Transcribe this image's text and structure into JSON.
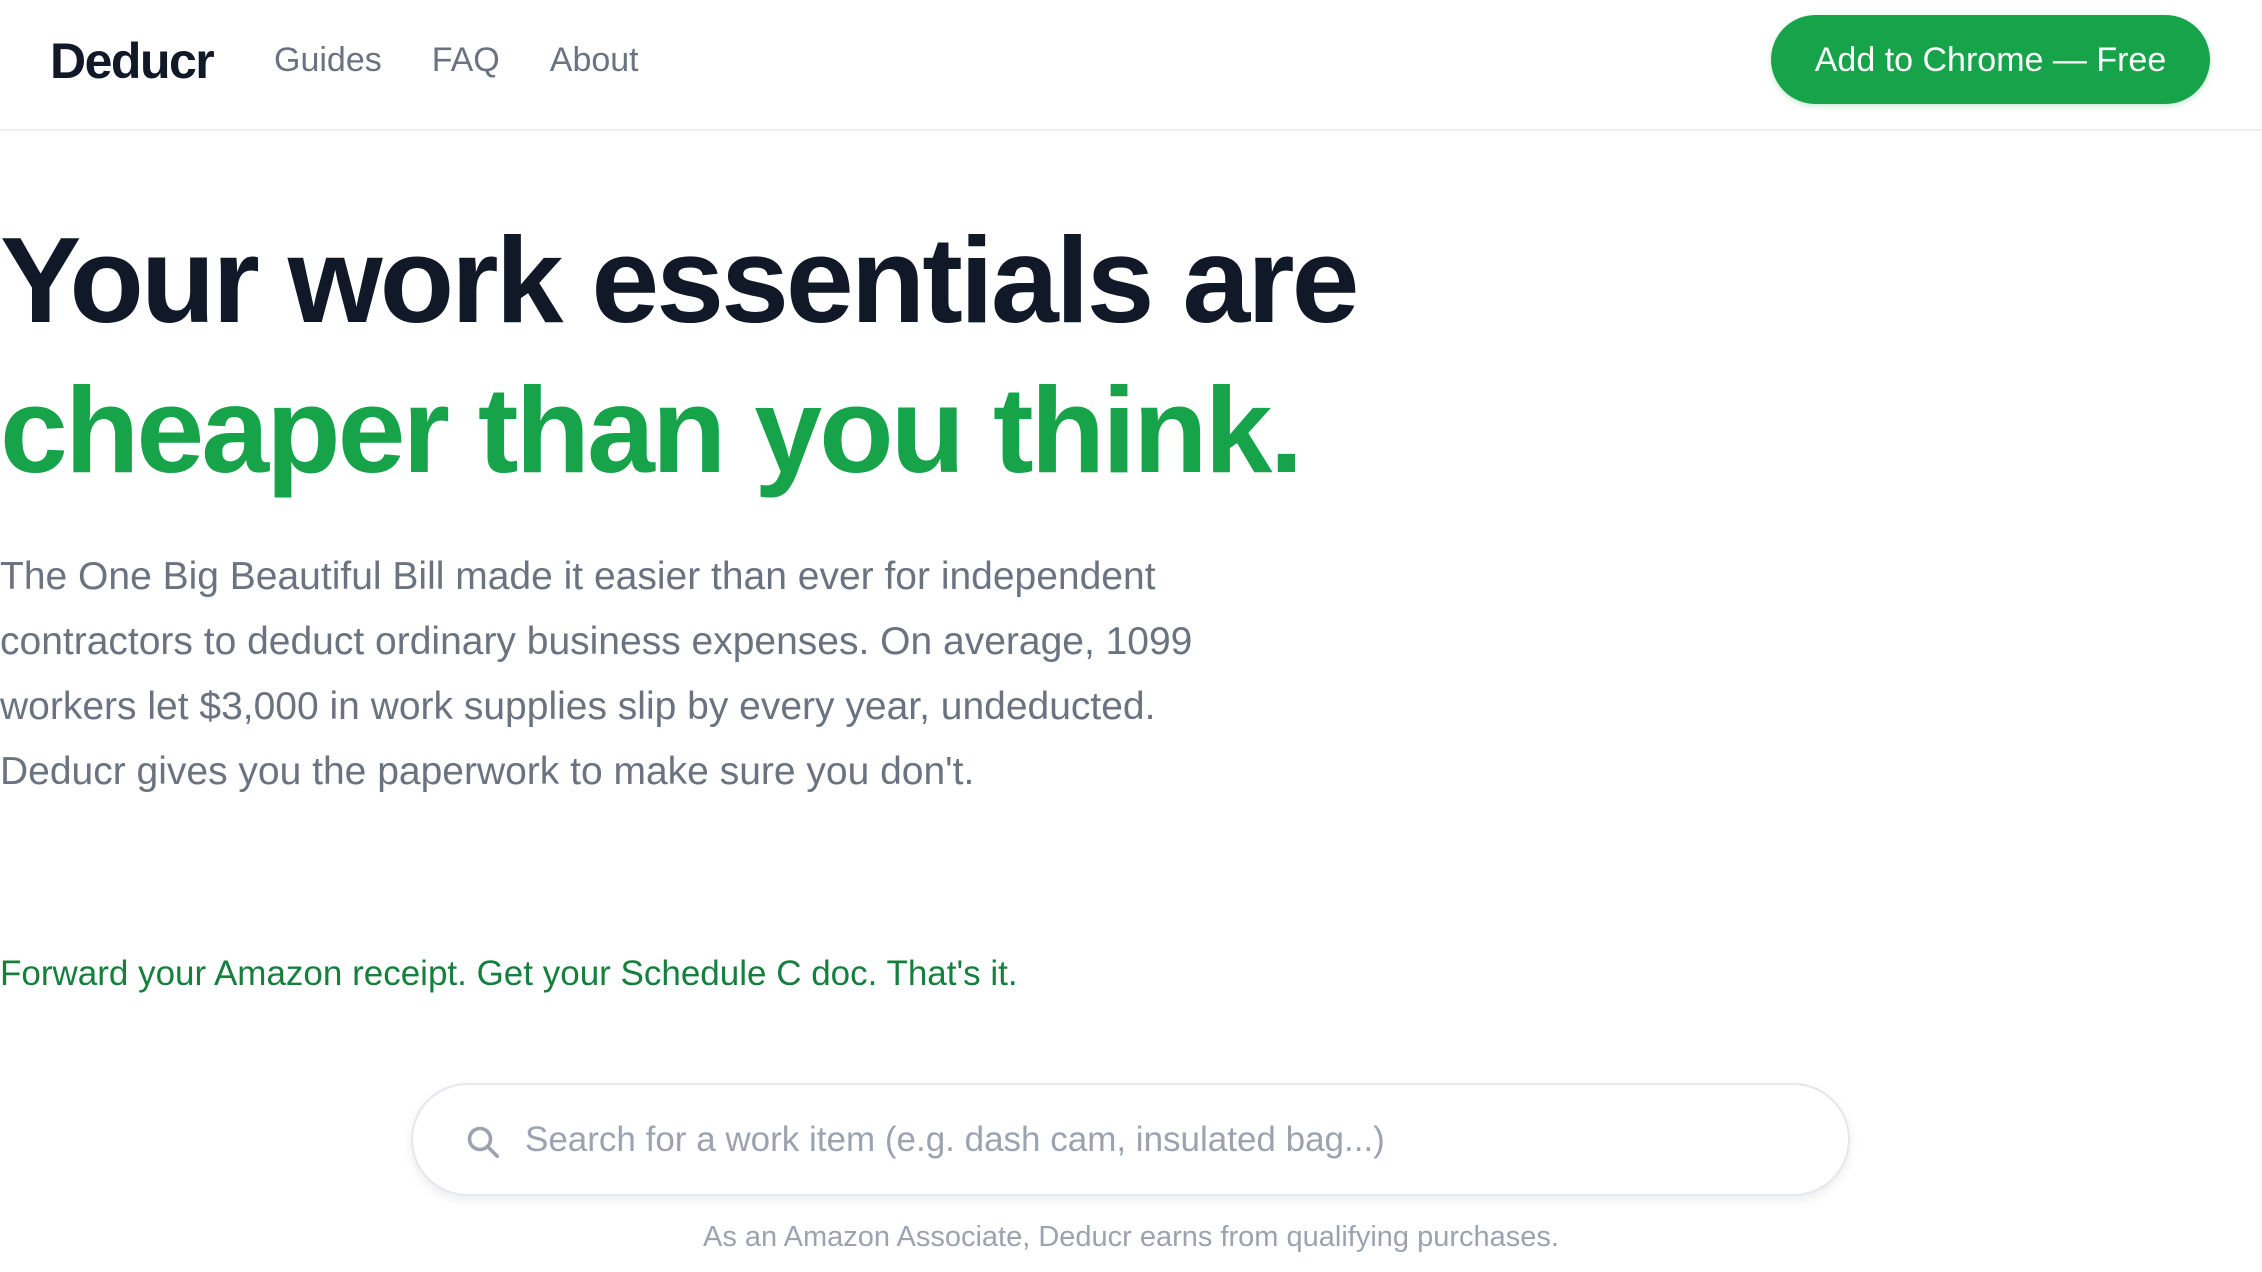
{
  "header": {
    "logo": "Deducr",
    "nav": [
      "Guides",
      "FAQ",
      "About"
    ],
    "cta_label": "Add to Chrome — Free"
  },
  "hero": {
    "headline_line1": "Your work essentials are",
    "headline_line2": "cheaper than you think.",
    "subtext_lines": [
      "The One Big Beautiful Bill made it easier than ever for independent",
      "contractors to deduct ordinary business expenses. On average, 1099",
      "workers let $3,000 in work supplies slip by every year, undeducted.",
      "Deducr gives you the paperwork to make sure you don't."
    ],
    "tagline": "Forward your Amazon receipt. Get your Schedule C doc. That's it."
  },
  "search": {
    "icon": "search-icon",
    "value": "",
    "placeholder": "Search for a work item (e.g. dash cam, insulated bag...)"
  },
  "footer": {
    "disclosure": "As an Amazon Associate, Deducr earns from qualifying purchases."
  },
  "colors": {
    "accent": "#16a34a",
    "tagline": "#15803d",
    "heading": "#111827",
    "muted": "#6b7280"
  }
}
